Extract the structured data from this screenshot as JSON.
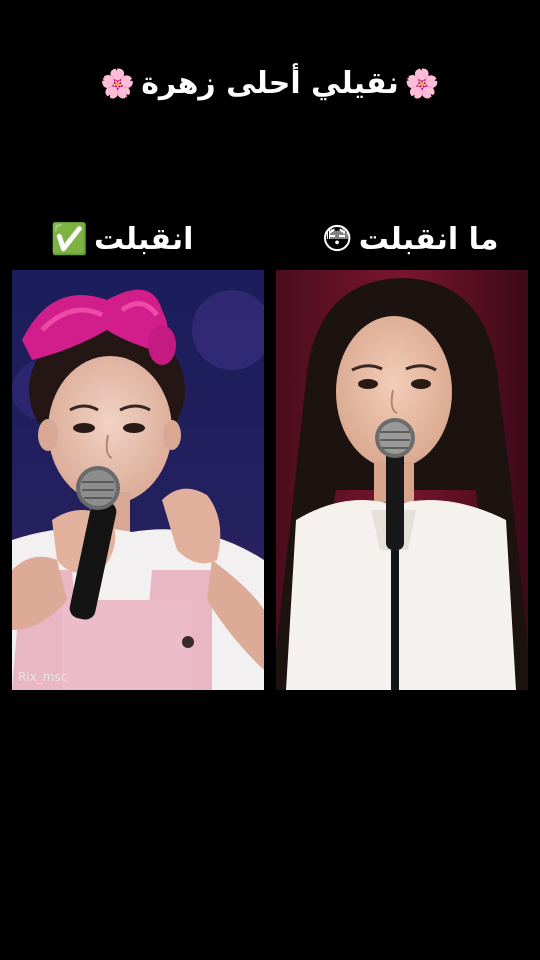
{
  "title": {
    "text": "نقيلي أحلى زهرة",
    "emoji": "🌸"
  },
  "labels": {
    "accepted": {
      "text": "انقبلت",
      "emoji": "✅"
    },
    "not_accepted": {
      "text": "ما انقبلت",
      "emoji": "😳"
    }
  },
  "watermark": "Rix_msc",
  "colors": {
    "background": "#000000",
    "text": "#ffffff"
  }
}
